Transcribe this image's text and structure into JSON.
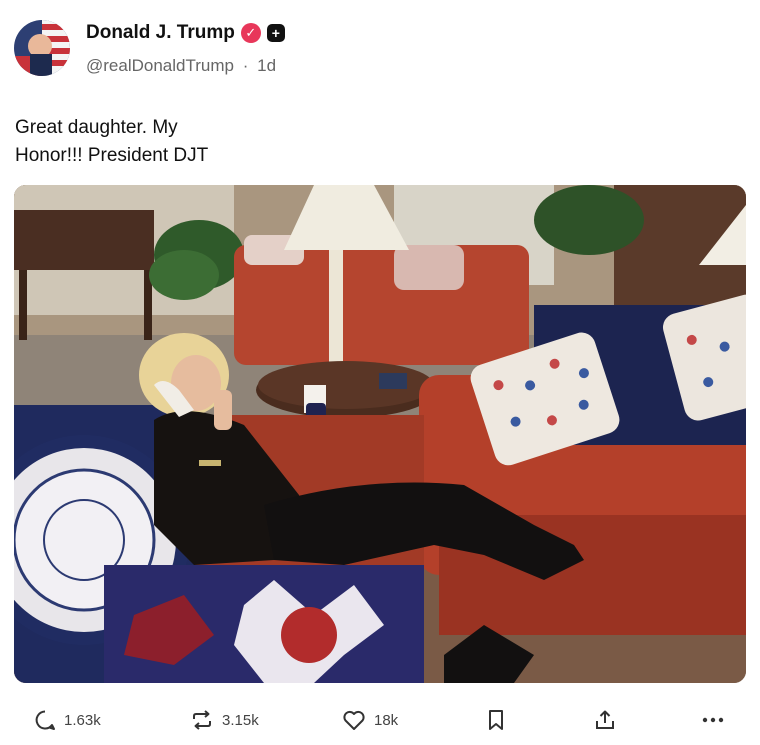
{
  "author": {
    "display_name": "Donald J. Trump",
    "handle": "@realDonaldTrump",
    "separator": "·",
    "time_ago": "1d",
    "verified_icon": "verified-check-icon",
    "plus_icon": "plus-square-icon"
  },
  "post": {
    "text": "Great daughter. My\nHonor!!! President DJT"
  },
  "actions": {
    "replies": "1.63k",
    "reposts": "3.15k",
    "likes": "18k"
  },
  "colors": {
    "verified": "#e8375a",
    "text": "#111111",
    "muted": "#666666"
  }
}
